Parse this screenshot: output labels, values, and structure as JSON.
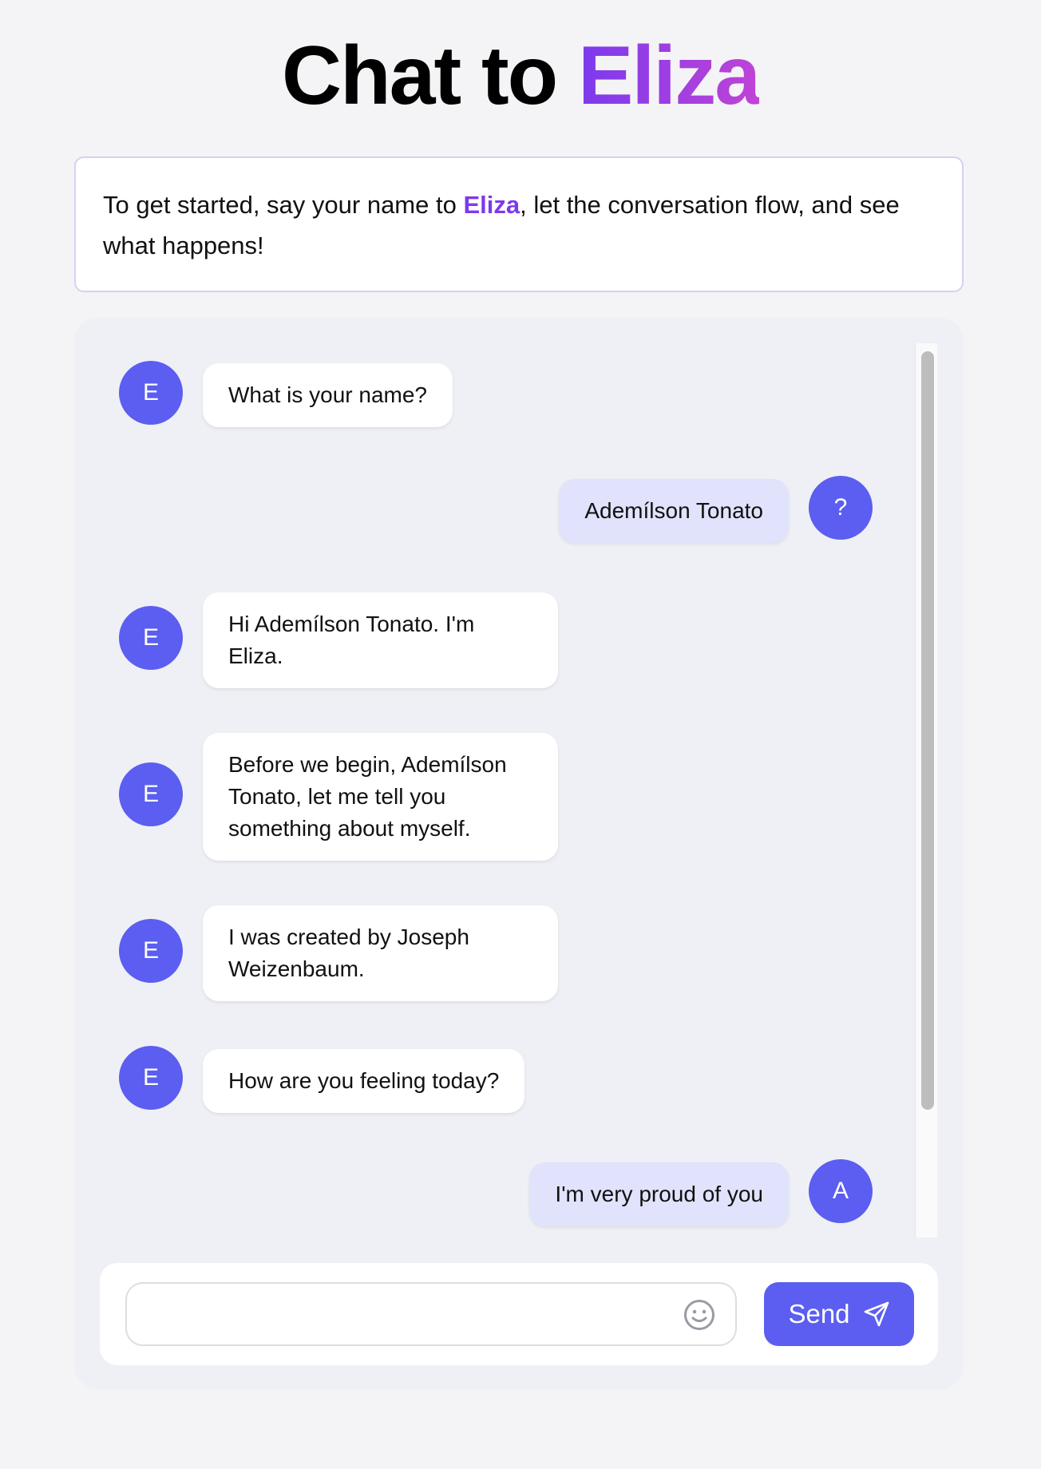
{
  "header": {
    "title_prefix": "Chat to ",
    "title_accent": "Eliza"
  },
  "intro": {
    "text_before": "To get started, say your name to ",
    "highlight": "Eliza",
    "text_after": ", let the conversation flow, and see what happens!"
  },
  "messages": [
    {
      "sender": "bot",
      "avatar": "E",
      "text": "What is your name?"
    },
    {
      "sender": "user",
      "avatar": "?",
      "text": "Ademílson Tonato"
    },
    {
      "sender": "bot",
      "avatar": "E",
      "text": "Hi Ademílson Tonato. I'm Eliza."
    },
    {
      "sender": "bot",
      "avatar": "E",
      "text": "Before we begin, Ademílson Tonato, let me tell you something about myself."
    },
    {
      "sender": "bot",
      "avatar": "E",
      "text": "I was created by Joseph Weizenbaum."
    },
    {
      "sender": "bot",
      "avatar": "E",
      "text": "How are you feeling today?"
    },
    {
      "sender": "user",
      "avatar": "A",
      "text": "I'm very proud of you"
    }
  ],
  "composer": {
    "input_value": "",
    "input_placeholder": "",
    "emoji_icon": "smiley-icon",
    "send_label": "Send",
    "send_icon": "paper-plane-icon"
  },
  "colors": {
    "accent": "#5b5ef0",
    "brand_purple": "#7c3aed",
    "user_bubble": "#e0e3fb",
    "bot_bubble": "#ffffff"
  }
}
